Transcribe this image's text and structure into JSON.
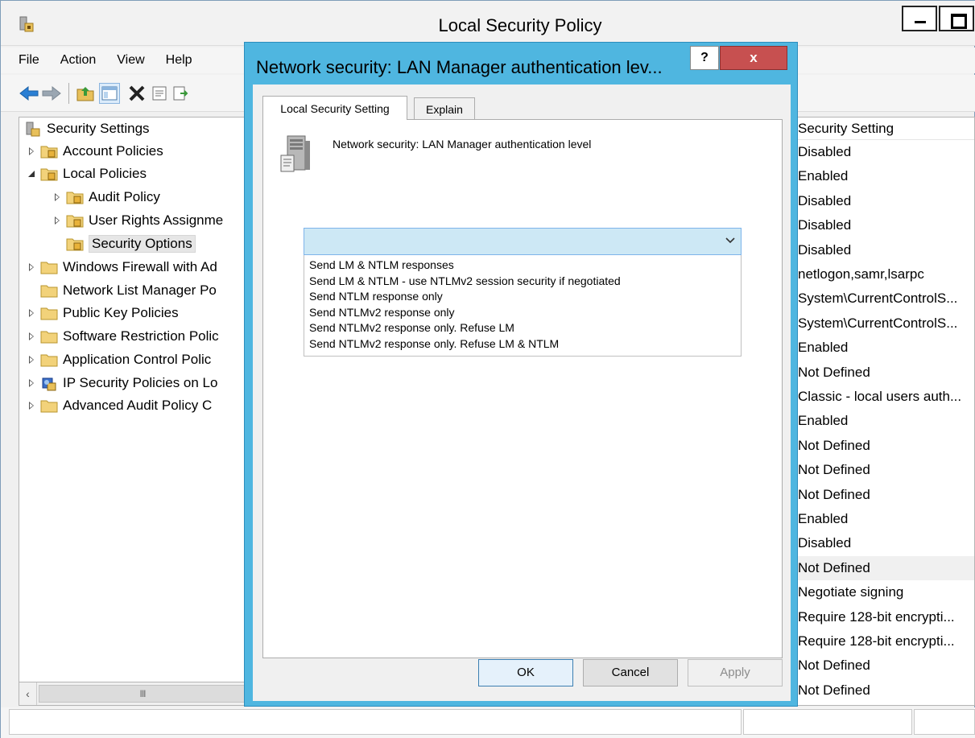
{
  "window": {
    "title": "Local Security Policy",
    "icon": "security-policy-icon"
  },
  "menu": {
    "items": [
      "File",
      "Action",
      "View",
      "Help"
    ]
  },
  "toolbar": {
    "icons": [
      "back-arrow-icon",
      "forward-arrow-icon",
      "up-folder-icon",
      "show-hide-tree-icon",
      "delete-icon",
      "properties-icon",
      "export-list-icon"
    ]
  },
  "tree": {
    "root": "Security Settings",
    "items": [
      {
        "label": "Account Policies"
      },
      {
        "label": "Local Policies"
      },
      {
        "label": "Audit Policy"
      },
      {
        "label": "User Rights Assignme"
      },
      {
        "label": "Security Options"
      },
      {
        "label": "Windows Firewall with Ad"
      },
      {
        "label": "Network List Manager Po"
      },
      {
        "label": "Public Key Policies"
      },
      {
        "label": "Software Restriction Polic"
      },
      {
        "label": "Application Control Polic"
      },
      {
        "label": "IP Security Policies on Lo"
      },
      {
        "label": "Advanced Audit Policy C"
      }
    ],
    "scroll_thumb_glyph": "III"
  },
  "list": {
    "header": "Security Setting",
    "rows": [
      "Disabled",
      "Enabled",
      "Disabled",
      "Disabled",
      "Disabled",
      "netlogon,samr,lsarpc",
      "System\\CurrentControlS...",
      "System\\CurrentControlS...",
      "Enabled",
      "Not Defined",
      "Classic - local users auth...",
      "Enabled",
      "Not Defined",
      "Not Defined",
      "Not Defined",
      "Enabled",
      "Disabled",
      "Not Defined",
      "Negotiate signing",
      "Require 128-bit encrypti...",
      "Require 128-bit encrypti...",
      "Not Defined",
      "Not Defined"
    ],
    "highlight_color": "#f0f0f0"
  },
  "dialog": {
    "title": "Network security: LAN Manager authentication lev...",
    "help_label": "?",
    "close_label": "x",
    "title_color": "#4fb6e0",
    "tabs": {
      "local": "Local Security Setting",
      "explain": "Explain"
    },
    "policy_name": "Network security: LAN Manager authentication level",
    "combo": {
      "selected": "",
      "options": [
        "Send LM & NTLM responses",
        "Send LM & NTLM - use NTLMv2 session security if negotiated",
        "Send NTLM response only",
        "Send NTLMv2 response only",
        "Send NTLMv2 response only. Refuse LM",
        "Send NTLMv2 response only. Refuse LM & NTLM"
      ]
    },
    "buttons": {
      "ok": "OK",
      "cancel": "Cancel",
      "apply": "Apply"
    }
  }
}
